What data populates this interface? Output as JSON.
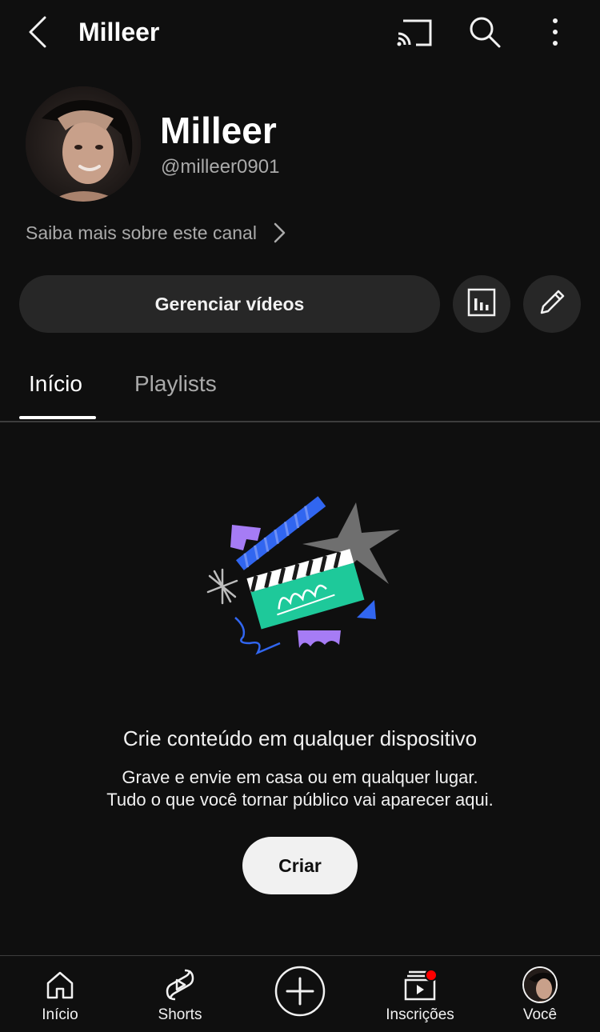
{
  "header": {
    "title": "Milleer",
    "icons": [
      "back-arrow-icon",
      "cast-icon",
      "search-icon",
      "more-vertical-icon"
    ]
  },
  "channel": {
    "name": "Milleer",
    "handle": "@milleer0901",
    "about_link": "Saiba mais sobre este canal"
  },
  "actions": {
    "manage_label": "Gerenciar vídeos",
    "analytics_icon": "analytics-icon",
    "edit_icon": "pencil-icon"
  },
  "tabs": [
    {
      "label": "Início",
      "active": true
    },
    {
      "label": "Playlists",
      "active": false
    }
  ],
  "empty_state": {
    "title": "Crie conteúdo em qualquer dispositivo",
    "line1": "Grave e envie em casa ou em qualquer lugar.",
    "line2": "Tudo o que você tornar público vai aparecer aqui.",
    "button_label": "Criar"
  },
  "bottom_nav": [
    {
      "label": "Início",
      "icon": "home-icon"
    },
    {
      "label": "Shorts",
      "icon": "shorts-icon"
    },
    {
      "label": "",
      "icon": "create-plus-icon"
    },
    {
      "label": "Inscrições",
      "icon": "subscriptions-icon",
      "badge": true
    },
    {
      "label": "Você",
      "icon": "avatar"
    }
  ],
  "colors": {
    "background": "#0f0f0f",
    "surface": "#272727",
    "text": "#f1f1f1",
    "muted": "#aaaaaa",
    "badge": "#ff0000",
    "accent_green": "#1ec99a",
    "accent_blue": "#3166f0",
    "accent_purple": "#a67cf5"
  }
}
